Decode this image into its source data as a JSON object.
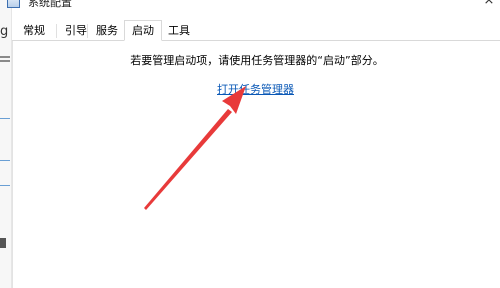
{
  "window": {
    "title": "系统配置",
    "close_glyph": "×"
  },
  "background_window": {
    "edge_letter": "g"
  },
  "tabs": [
    {
      "label": "常规",
      "selected": false
    },
    {
      "label": "引导",
      "selected": false
    },
    {
      "label": "服务",
      "selected": false
    },
    {
      "label": "启动",
      "selected": true
    },
    {
      "label": "工具",
      "selected": false
    }
  ],
  "startup_tab": {
    "info_text": "若要管理启动项，请使用任务管理器的“启动”部分。",
    "link_text": "打开任务管理器"
  },
  "annotation": {
    "type": "arrow",
    "color": "#e83a3a",
    "points_to": "open-task-manager-link"
  },
  "icons": {
    "app": "system-config-icon",
    "close": "close-icon"
  },
  "colors": {
    "link": "#0a58b6",
    "arrow": "#e83a3a",
    "tab_border": "#d9d9d9"
  }
}
